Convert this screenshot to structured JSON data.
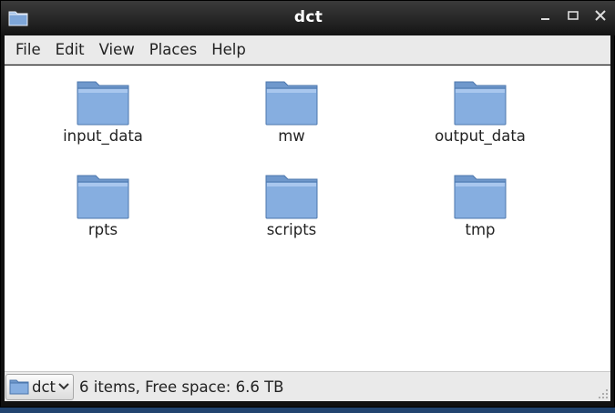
{
  "window": {
    "title": "dct"
  },
  "menubar": {
    "items": [
      "File",
      "Edit",
      "View",
      "Places",
      "Help"
    ]
  },
  "files": [
    {
      "name": "input_data",
      "icon": "folder-icon"
    },
    {
      "name": "mw",
      "icon": "folder-icon"
    },
    {
      "name": "output_data",
      "icon": "folder-icon"
    },
    {
      "name": "rpts",
      "icon": "folder-icon"
    },
    {
      "name": "scripts",
      "icon": "folder-icon"
    },
    {
      "name": "tmp",
      "icon": "folder-icon"
    }
  ],
  "statusbar": {
    "location": "dct",
    "info": "6 items, Free space: 6.6 TB"
  },
  "colors": {
    "folder": "#7ea6d8",
    "folder_dark": "#4c77ad",
    "titlebar": "#2a2a2a"
  }
}
